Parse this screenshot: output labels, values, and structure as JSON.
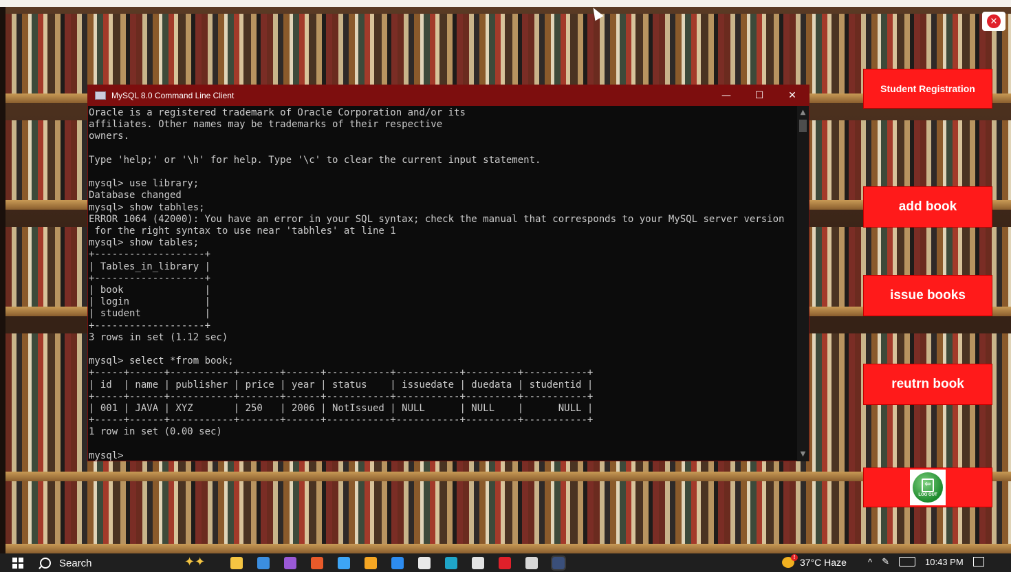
{
  "console": {
    "title": "MySQL 8.0 Command Line Client",
    "minimize_glyph": "—",
    "maximize_glyph": "☐",
    "close_glyph": "✕",
    "lines": [
      "Oracle is a registered trademark of Oracle Corporation and/or its",
      "affiliates. Other names may be trademarks of their respective",
      "owners.",
      "",
      "Type 'help;' or '\\h' for help. Type '\\c' to clear the current input statement.",
      "",
      "mysql> use library;",
      "Database changed",
      "mysql> show tabhles;",
      "ERROR 1064 (42000): You have an error in your SQL syntax; check the manual that corresponds to your MySQL server version",
      " for the right syntax to use near 'tabhles' at line 1",
      "mysql> show tables;",
      "+-------------------+",
      "| Tables_in_library |",
      "+-------------------+",
      "| book              |",
      "| login             |",
      "| student           |",
      "+-------------------+",
      "3 rows in set (1.12 sec)",
      "",
      "mysql> select *from book;",
      "+-----+------+-----------+-------+------+-----------+-----------+---------+-----------+",
      "| id  | name | publisher | price | year | status    | issuedate | duedata | studentid |",
      "+-----+------+-----------+-------+------+-----------+-----------+---------+-----------+",
      "| 001 | JAVA | XYZ       | 250   | 2006 | NotIssued | NULL      | NULL    |      NULL |",
      "+-----+------+-----------+-------+------+-----------+-----------+---------+-----------+",
      "1 row in set (0.00 sec)",
      "",
      "mysql>"
    ]
  },
  "app": {
    "close_glyph": "✕",
    "buttons": {
      "student_registration": "Student Registration",
      "add_book": "add book",
      "issue_books": "issue books",
      "return_book": "reutrn book",
      "logout_label": "LOG OUT"
    }
  },
  "taskbar": {
    "search_label": "Search",
    "weather": "37°C  Haze",
    "time": "10:43 PM",
    "icons": [
      "widgets-icon",
      "task-view-icon",
      "photos-icon",
      "paint-icon",
      "copilot-icon",
      "firefox-icon",
      "file-explorer-icon",
      "notepad-icon",
      "edge-icon",
      "chrome-icon",
      "record-icon",
      "java-icon",
      "mysql-console-icon"
    ],
    "icon_colors": [
      "#f5c542",
      "#3b8ee0",
      "#9a59d6",
      "#e85a2a",
      "#3da5f5",
      "#f5a623",
      "#2d8cf0",
      "#e8e8e8",
      "#1fa5c8",
      "#e3e3e3",
      "#e0202a",
      "#d8d8d8",
      "#3a4f7a"
    ]
  }
}
